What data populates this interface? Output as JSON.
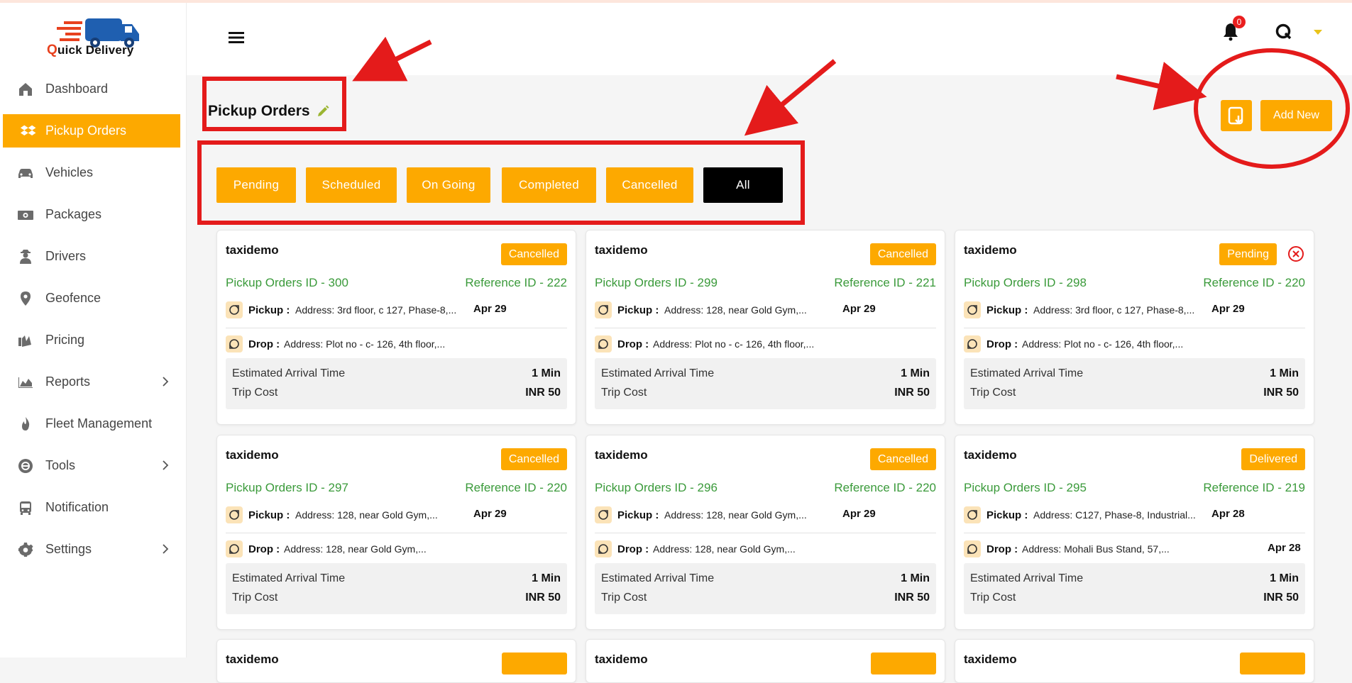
{
  "app": {
    "logo_q": "Q",
    "logo_rest": "uick Delivery"
  },
  "sidebar": {
    "items": [
      {
        "label": "Dashboard",
        "icon": "home-icon"
      },
      {
        "label": "Pickup Orders",
        "icon": "dropbox-icon",
        "active": true
      },
      {
        "label": "Vehicles",
        "icon": "car-icon"
      },
      {
        "label": "Packages",
        "icon": "money-icon"
      },
      {
        "label": "Drivers",
        "icon": "user-secret-icon"
      },
      {
        "label": "Geofence",
        "icon": "map-pin-icon"
      },
      {
        "label": "Pricing",
        "icon": "pricing-icon"
      },
      {
        "label": "Reports",
        "icon": "area-chart-icon",
        "expandable": true
      },
      {
        "label": "Fleet Management",
        "icon": "fire-icon"
      },
      {
        "label": "Tools",
        "icon": "tools-icon",
        "expandable": true
      },
      {
        "label": "Notification",
        "icon": "bus-icon"
      },
      {
        "label": "Settings",
        "icon": "gear-icon",
        "expandable": true
      }
    ]
  },
  "header": {
    "notification_count": "0"
  },
  "page": {
    "title": "Pickup Orders",
    "add_new_label": "Add New"
  },
  "filters": [
    "Pending",
    "Scheduled",
    "On Going",
    "Completed",
    "Cancelled",
    "All"
  ],
  "selected_filter": "All",
  "labels": {
    "pickup": "Pickup :",
    "drop": "Drop :",
    "eta": "Estimated Arrival Time",
    "trip_cost": "Trip Cost"
  },
  "orders": [
    {
      "name": "taxidemo",
      "status": "Cancelled",
      "pickup_id": "Pickup Orders ID - 300",
      "ref_id": "Reference ID - 222",
      "pickup_addr": "Address: 3rd floor, c 127, Phase-8,...",
      "pickup_date": "Apr 29",
      "drop_addr": "Address: Plot no - c- 126, 4th floor,...",
      "drop_date": "",
      "eta": "1 Min",
      "cost": "INR 50"
    },
    {
      "name": "taxidemo",
      "status": "Cancelled",
      "pickup_id": "Pickup Orders ID - 299",
      "ref_id": "Reference ID - 221",
      "pickup_addr": "Address: 128, near Gold Gym,...",
      "pickup_date": "Apr 29",
      "drop_addr": "Address: Plot no - c- 126, 4th floor,...",
      "drop_date": "",
      "eta": "1 Min",
      "cost": "INR 50"
    },
    {
      "name": "taxidemo",
      "status": "Pending",
      "pickup_id": "Pickup Orders ID - 298",
      "ref_id": "Reference ID - 220",
      "pickup_addr": "Address: 3rd floor, c 127, Phase-8,...",
      "pickup_date": "Apr 29",
      "drop_addr": "Address: Plot no - c- 126, 4th floor,...",
      "drop_date": "",
      "eta": "1 Min",
      "cost": "INR 50"
    },
    {
      "name": "taxidemo",
      "status": "Cancelled",
      "pickup_id": "Pickup Orders ID - 297",
      "ref_id": "Reference ID - 220",
      "pickup_addr": "Address: 128, near Gold Gym,...",
      "pickup_date": "Apr 29",
      "drop_addr": "Address: 128, near Gold Gym,...",
      "drop_date": "",
      "eta": "1 Min",
      "cost": "INR 50"
    },
    {
      "name": "taxidemo",
      "status": "Cancelled",
      "pickup_id": "Pickup Orders ID - 296",
      "ref_id": "Reference ID - 220",
      "pickup_addr": "Address: 128, near Gold Gym,...",
      "pickup_date": "Apr 29",
      "drop_addr": "Address: 128, near Gold Gym,...",
      "drop_date": "",
      "eta": "1 Min",
      "cost": "INR 50"
    },
    {
      "name": "taxidemo",
      "status": "Delivered",
      "pickup_id": "Pickup Orders ID - 295",
      "ref_id": "Reference ID - 219",
      "pickup_addr": "Address: C127, Phase-8, Industrial...",
      "pickup_date": "Apr 28",
      "drop_addr": "Address: Mohali Bus Stand, 57,...",
      "drop_date": "Apr 28",
      "eta": "1 Min",
      "cost": "INR 50"
    },
    {
      "name": "taxidemo",
      "status": "",
      "pickup_id": "",
      "ref_id": ""
    },
    {
      "name": "taxidemo",
      "status": "",
      "pickup_id": "",
      "ref_id": ""
    },
    {
      "name": "taxidemo",
      "status": "",
      "pickup_id": "",
      "ref_id": ""
    }
  ],
  "colors": {
    "accent": "#fda900",
    "selected_filter": "#000000",
    "id_text": "#3a9a3a",
    "annotation": "#e41b1b"
  }
}
